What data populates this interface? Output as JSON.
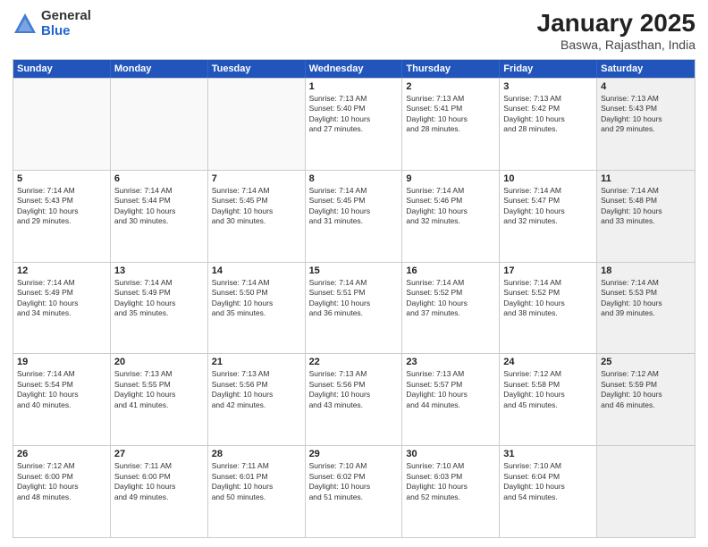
{
  "logo": {
    "general": "General",
    "blue": "Blue"
  },
  "title": "January 2025",
  "location": "Baswa, Rajasthan, India",
  "dayHeaders": [
    "Sunday",
    "Monday",
    "Tuesday",
    "Wednesday",
    "Thursday",
    "Friday",
    "Saturday"
  ],
  "weeks": [
    [
      {
        "num": "",
        "info": "",
        "empty": true
      },
      {
        "num": "",
        "info": "",
        "empty": true
      },
      {
        "num": "",
        "info": "",
        "empty": true
      },
      {
        "num": "1",
        "info": "Sunrise: 7:13 AM\nSunset: 5:40 PM\nDaylight: 10 hours\nand 27 minutes."
      },
      {
        "num": "2",
        "info": "Sunrise: 7:13 AM\nSunset: 5:41 PM\nDaylight: 10 hours\nand 28 minutes."
      },
      {
        "num": "3",
        "info": "Sunrise: 7:13 AM\nSunset: 5:42 PM\nDaylight: 10 hours\nand 28 minutes."
      },
      {
        "num": "4",
        "info": "Sunrise: 7:13 AM\nSunset: 5:43 PM\nDaylight: 10 hours\nand 29 minutes.",
        "shaded": true
      }
    ],
    [
      {
        "num": "5",
        "info": "Sunrise: 7:14 AM\nSunset: 5:43 PM\nDaylight: 10 hours\nand 29 minutes."
      },
      {
        "num": "6",
        "info": "Sunrise: 7:14 AM\nSunset: 5:44 PM\nDaylight: 10 hours\nand 30 minutes."
      },
      {
        "num": "7",
        "info": "Sunrise: 7:14 AM\nSunset: 5:45 PM\nDaylight: 10 hours\nand 30 minutes."
      },
      {
        "num": "8",
        "info": "Sunrise: 7:14 AM\nSunset: 5:45 PM\nDaylight: 10 hours\nand 31 minutes."
      },
      {
        "num": "9",
        "info": "Sunrise: 7:14 AM\nSunset: 5:46 PM\nDaylight: 10 hours\nand 32 minutes."
      },
      {
        "num": "10",
        "info": "Sunrise: 7:14 AM\nSunset: 5:47 PM\nDaylight: 10 hours\nand 32 minutes."
      },
      {
        "num": "11",
        "info": "Sunrise: 7:14 AM\nSunset: 5:48 PM\nDaylight: 10 hours\nand 33 minutes.",
        "shaded": true
      }
    ],
    [
      {
        "num": "12",
        "info": "Sunrise: 7:14 AM\nSunset: 5:49 PM\nDaylight: 10 hours\nand 34 minutes."
      },
      {
        "num": "13",
        "info": "Sunrise: 7:14 AM\nSunset: 5:49 PM\nDaylight: 10 hours\nand 35 minutes."
      },
      {
        "num": "14",
        "info": "Sunrise: 7:14 AM\nSunset: 5:50 PM\nDaylight: 10 hours\nand 35 minutes."
      },
      {
        "num": "15",
        "info": "Sunrise: 7:14 AM\nSunset: 5:51 PM\nDaylight: 10 hours\nand 36 minutes."
      },
      {
        "num": "16",
        "info": "Sunrise: 7:14 AM\nSunset: 5:52 PM\nDaylight: 10 hours\nand 37 minutes."
      },
      {
        "num": "17",
        "info": "Sunrise: 7:14 AM\nSunset: 5:52 PM\nDaylight: 10 hours\nand 38 minutes."
      },
      {
        "num": "18",
        "info": "Sunrise: 7:14 AM\nSunset: 5:53 PM\nDaylight: 10 hours\nand 39 minutes.",
        "shaded": true
      }
    ],
    [
      {
        "num": "19",
        "info": "Sunrise: 7:14 AM\nSunset: 5:54 PM\nDaylight: 10 hours\nand 40 minutes."
      },
      {
        "num": "20",
        "info": "Sunrise: 7:13 AM\nSunset: 5:55 PM\nDaylight: 10 hours\nand 41 minutes."
      },
      {
        "num": "21",
        "info": "Sunrise: 7:13 AM\nSunset: 5:56 PM\nDaylight: 10 hours\nand 42 minutes."
      },
      {
        "num": "22",
        "info": "Sunrise: 7:13 AM\nSunset: 5:56 PM\nDaylight: 10 hours\nand 43 minutes."
      },
      {
        "num": "23",
        "info": "Sunrise: 7:13 AM\nSunset: 5:57 PM\nDaylight: 10 hours\nand 44 minutes."
      },
      {
        "num": "24",
        "info": "Sunrise: 7:12 AM\nSunset: 5:58 PM\nDaylight: 10 hours\nand 45 minutes."
      },
      {
        "num": "25",
        "info": "Sunrise: 7:12 AM\nSunset: 5:59 PM\nDaylight: 10 hours\nand 46 minutes.",
        "shaded": true
      }
    ],
    [
      {
        "num": "26",
        "info": "Sunrise: 7:12 AM\nSunset: 6:00 PM\nDaylight: 10 hours\nand 48 minutes."
      },
      {
        "num": "27",
        "info": "Sunrise: 7:11 AM\nSunset: 6:00 PM\nDaylight: 10 hours\nand 49 minutes."
      },
      {
        "num": "28",
        "info": "Sunrise: 7:11 AM\nSunset: 6:01 PM\nDaylight: 10 hours\nand 50 minutes."
      },
      {
        "num": "29",
        "info": "Sunrise: 7:10 AM\nSunset: 6:02 PM\nDaylight: 10 hours\nand 51 minutes."
      },
      {
        "num": "30",
        "info": "Sunrise: 7:10 AM\nSunset: 6:03 PM\nDaylight: 10 hours\nand 52 minutes."
      },
      {
        "num": "31",
        "info": "Sunrise: 7:10 AM\nSunset: 6:04 PM\nDaylight: 10 hours\nand 54 minutes."
      },
      {
        "num": "",
        "info": "",
        "empty": true,
        "shaded": true
      }
    ]
  ]
}
